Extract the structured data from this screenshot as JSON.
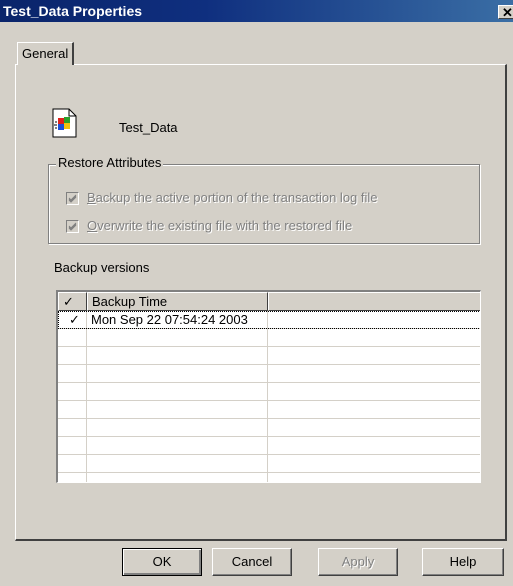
{
  "window": {
    "title": "Test_Data Properties",
    "close_glyph": "✕"
  },
  "tabs": [
    {
      "label": "General",
      "selected": true
    }
  ],
  "file": {
    "name": "Test_Data",
    "icon": "windows-file-icon"
  },
  "restore_attributes": {
    "label": "Restore Attributes",
    "options": [
      {
        "accel": "B",
        "rest": "ackup the active portion of the transaction log file",
        "checked": true,
        "enabled": false
      },
      {
        "accel": "O",
        "rest": "verwrite the existing file with the restored file",
        "checked": true,
        "enabled": false
      }
    ]
  },
  "backup_versions": {
    "label": "Backup versions",
    "columns": [
      "✓",
      "Backup Time",
      ""
    ],
    "rows": [
      {
        "check": "✓",
        "time": "Mon Sep 22 07:54:24 2003"
      }
    ]
  },
  "buttons": {
    "ok": "OK",
    "cancel": "Cancel",
    "apply": "Apply",
    "help": "Help"
  },
  "colors": {
    "title_bar": "#0a246a",
    "face": "#d4d0c8"
  }
}
